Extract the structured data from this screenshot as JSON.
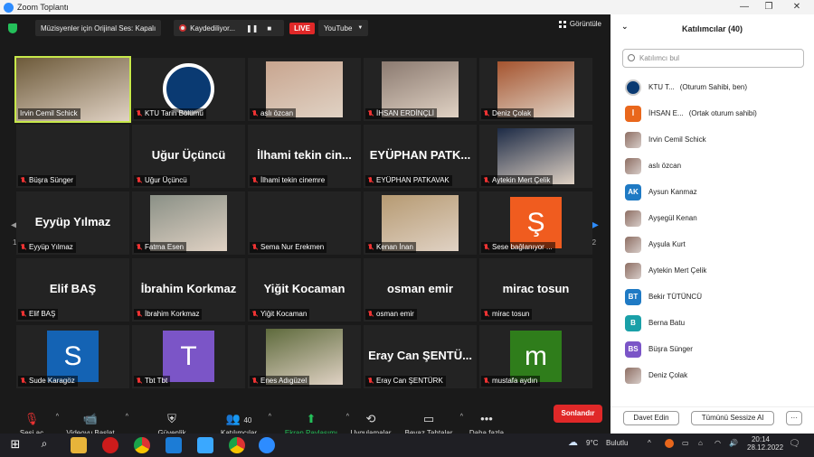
{
  "window": {
    "title": "Zoom Toplantı"
  },
  "topbar": {
    "audio_label": "Müzisyenler için Orijinal Ses: Kapalı",
    "recording_label": "Kaydediliyor...",
    "live_label": "LIVE",
    "stream_target": "YouTube",
    "view_label": "Görüntüle"
  },
  "grid": {
    "page": "1/2",
    "tiles": [
      {
        "name": "Irvin Cemil Schick",
        "big": "",
        "type": "video",
        "color": "#6d5a3a",
        "active": true,
        "muted": false
      },
      {
        "name": "KTU Tarih Bölümü",
        "big": "",
        "type": "logo",
        "color": "#0a3a72",
        "muted": true
      },
      {
        "name": "aslı özcan",
        "big": "",
        "type": "video",
        "color": "#c8a58f",
        "muted": true
      },
      {
        "name": "İHSAN ERDİNÇLİ",
        "big": "",
        "type": "video",
        "color": "#8b7a70",
        "muted": true
      },
      {
        "name": "Deniz Çolak",
        "big": "",
        "type": "video",
        "color": "#a5542f",
        "muted": true
      },
      {
        "name": "Büşra Sünger",
        "big": "",
        "type": "empty",
        "color": "",
        "muted": true
      },
      {
        "name": "Uğur Üçüncü",
        "big": "Uğur Üçüncü",
        "type": "text",
        "color": "",
        "muted": true
      },
      {
        "name": "İlhami tekin cinemre",
        "big": "İlhami tekin cin...",
        "type": "text",
        "color": "",
        "muted": true
      },
      {
        "name": "EYÜPHAN PATKAVAK",
        "big": "EYÜPHAN PATK...",
        "type": "text",
        "color": "",
        "muted": true
      },
      {
        "name": "Aytekin Mert Çelik",
        "big": "",
        "type": "video",
        "color": "#1d2b46",
        "muted": true
      },
      {
        "name": "Eyyüp Yılmaz",
        "big": "Eyyüp Yılmaz",
        "type": "text",
        "color": "",
        "muted": true
      },
      {
        "name": "Fatma Esen",
        "big": "",
        "type": "video",
        "color": "#8a9086",
        "muted": true
      },
      {
        "name": "Sema Nur Erekmen",
        "big": "",
        "type": "empty",
        "color": "",
        "muted": true
      },
      {
        "name": "Kenan İnan",
        "big": "",
        "type": "video",
        "color": "#b69a72",
        "muted": true
      },
      {
        "name": "Sese bağlanıyor ...",
        "big": "",
        "type": "avatar",
        "letter": "Ş",
        "color": "#f05c1f",
        "muted": true
      },
      {
        "name": "Elif BAŞ",
        "big": "Elif BAŞ",
        "type": "text",
        "color": "",
        "muted": true
      },
      {
        "name": "İbrahim Korkmaz",
        "big": "İbrahim Korkmaz",
        "type": "text",
        "color": "",
        "muted": true
      },
      {
        "name": "Yiğit Kocaman",
        "big": "Yiğit Kocaman",
        "type": "text",
        "color": "",
        "muted": true
      },
      {
        "name": "osman emir",
        "big": "osman emir",
        "type": "text",
        "color": "",
        "muted": true
      },
      {
        "name": "mirac tosun",
        "big": "mirac tosun",
        "type": "text",
        "color": "",
        "muted": true
      },
      {
        "name": "Sude Karagöz",
        "big": "",
        "type": "avatar",
        "letter": "S",
        "color": "#1463b4",
        "muted": true
      },
      {
        "name": "Tbt Tbt",
        "big": "",
        "type": "avatar",
        "letter": "T",
        "color": "#7b55c7",
        "muted": true
      },
      {
        "name": "Enes Adıgüzel",
        "big": "",
        "type": "video",
        "color": "#5e6a3c",
        "muted": true
      },
      {
        "name": "Eray Can ŞENTÜRK",
        "big": "Eray Can ŞENTÜ...",
        "type": "text",
        "color": "",
        "muted": true
      },
      {
        "name": "mustafa aydın",
        "big": "",
        "type": "avatar",
        "letter": "m",
        "color": "#2f7d1b",
        "muted": true
      }
    ]
  },
  "toolbar": {
    "audio": "Sesi aç",
    "video": "Videoyu Başlat",
    "security": "Güvenlik",
    "participants": "Katılımcılar",
    "participant_count": "40",
    "share": "Ekran Paylaşımı",
    "apps": "Uygulamalar",
    "whiteboards": "Beyaz Tahtalar",
    "more": "Daha fazla",
    "end": "Sonlandır"
  },
  "panel": {
    "title": "Katılımcılar (40)",
    "search_placeholder": "Katılımcı bul",
    "participants": [
      {
        "name": "KTU T...",
        "role": "(Oturum Sahibi, ben)",
        "avatar": "logo",
        "color": "#0a3a72",
        "mic": "on",
        "rec": true,
        "video": "off"
      },
      {
        "name": "İHSAN E...",
        "role": "(Ortak oturum sahibi)",
        "avatar": "İ",
        "color": "#e9671c",
        "mic": "off",
        "rec": false,
        "video": "on"
      },
      {
        "name": "Irvin Cemil Schick",
        "role": "",
        "avatar": "photo",
        "color": "",
        "mic": "on",
        "rec": false,
        "video": "on"
      },
      {
        "name": "aslı özcan",
        "role": "",
        "avatar": "photo",
        "color": "",
        "mic": "off",
        "rec": false,
        "video": "on"
      },
      {
        "name": "Aysun Kanmaz",
        "role": "",
        "avatar": "AK",
        "color": "#1f7ac4",
        "mic": "off",
        "rec": false,
        "video": "off"
      },
      {
        "name": "Ayşegül Kenan",
        "role": "",
        "avatar": "photo",
        "color": "",
        "mic": "off",
        "rec": false,
        "video": "off"
      },
      {
        "name": "Ayşula Kurt",
        "role": "",
        "avatar": "photo",
        "color": "",
        "mic": "off",
        "rec": false,
        "video": "off"
      },
      {
        "name": "Aytekin Mert Çelik",
        "role": "",
        "avatar": "photo",
        "color": "",
        "mic": "off",
        "rec": false,
        "video": "off"
      },
      {
        "name": "Bekir TÜTÜNCÜ",
        "role": "",
        "avatar": "BT",
        "color": "#1f7ac4",
        "mic": "off",
        "rec": false,
        "video": "off"
      },
      {
        "name": "Berna Batu",
        "role": "",
        "avatar": "B",
        "color": "#1aa0a8",
        "mic": "off",
        "rec": false,
        "video": "off"
      },
      {
        "name": "Büşra Sünger",
        "role": "",
        "avatar": "BS",
        "color": "#7b55c7",
        "mic": "off",
        "rec": false,
        "video": "off"
      },
      {
        "name": "Deniz Çolak",
        "role": "",
        "avatar": "photo",
        "color": "",
        "mic": "off",
        "rec": false,
        "video": "on"
      }
    ],
    "invite": "Davet Edin",
    "mute_all": "Tümünü Sessize Al",
    "more": "···"
  },
  "taskbar": {
    "weather_temp": "9°C",
    "weather_text": "Bulutlu",
    "time": "20:14",
    "date": "28.12.2022"
  }
}
